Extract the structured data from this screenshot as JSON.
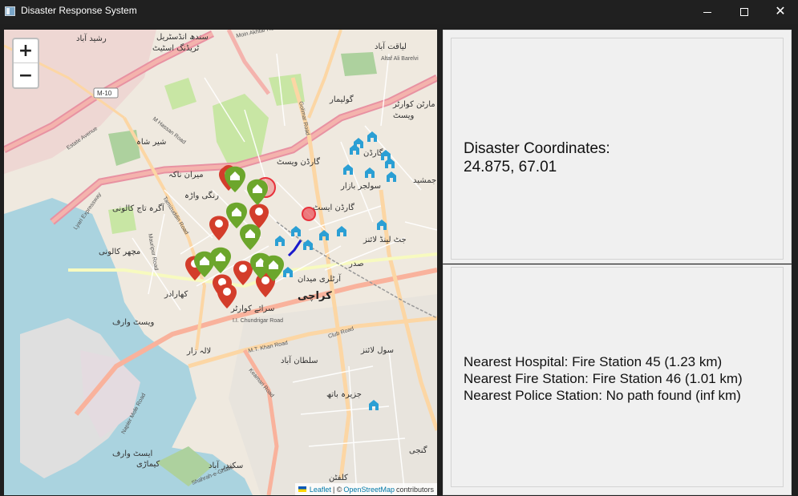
{
  "window": {
    "title": "Disaster Response System",
    "controls": {
      "minimize_icon": "minimize-icon",
      "maximize_icon": "maximize-icon",
      "close_icon": "close-icon",
      "close_glyph": "✕"
    }
  },
  "map": {
    "zoom_in_label": "+",
    "zoom_out_label": "−",
    "attribution": {
      "leaflet": "Leaflet",
      "sep": "| ©",
      "osm": "OpenStreetMap",
      "contributors": "contributors"
    },
    "labels": {
      "rashid_abad": "رشید آباد",
      "sindh_industrial": "سندھ انڈسٹریل",
      "trading_estate": "ٹریڈنگ اسٹیٹ",
      "liaquatabad": "لیاقت آباد",
      "golimar": "گولیمار",
      "martin_quarters": "مارٹن کوارٹر",
      "west": "ویسٹ",
      "sher_shah": "شیر شاہ",
      "garden": "گارڈن",
      "garden_west": "گارڈن ویسٹ",
      "soldier_bazaar": "سولجر بازار",
      "miran_naka": "میران ناکہ",
      "rangiwara": "رنگی واڑہ",
      "agra_taj": "آگرہ تاج کالونی",
      "garden_east": "گارڈن ایسٹ",
      "jamshed_road": "جمشید",
      "machar_colony": "مچھر کالونی",
      "kharadar": "کھارادر",
      "saddar": "صدر",
      "jut_land": "جٹ لینڈ لائنز",
      "artillery_maidan": "آرٹلری میدان",
      "karachi": "کراچی",
      "west_wharf": "ویسٹ وارف",
      "sarai_quarter": "سرائے کوارٹر",
      "lala_zar": "لالہ زار",
      "sultanabad": "سلطان آباد",
      "sol_lines": "سول لائنز",
      "jazira_bath": "جزیرہ باتھ",
      "east_wharf": "ایسٹ وارف",
      "kemari": "کیماڑی",
      "sikandarabad": "سکندر آباد",
      "clifton": "کلفٹن",
      "ginza": "گنجی",
      "hasan_road": "M Hassan Road",
      "estate_ave": "Estate Avenue",
      "mauripur": "Mauripur Road",
      "chundrigar": "I.I. Chundrigar Road",
      "mt_khan": "M.T. Khan Road",
      "keamari_rd": "Keamari Road",
      "napier_mole": "Napier Mole Road",
      "club_road": "Club Road",
      "shahrah": "Shahrah-e-Ghalib",
      "m10": "M-10",
      "moin_akhtar": "Moin Akhtar Road",
      "altaf_ali": "Altaf Ali Barelvi",
      "guru_mandir": "Golimar Road",
      "tamizuddin": "Tamizuddin Road",
      "lyari": "Lyari Expressway"
    }
  },
  "panels": {
    "disaster": {
      "title": "Disaster Coordinates:",
      "value": "24.875, 67.01"
    },
    "nearest": {
      "hospital": "Nearest Hospital: Fire Station 45 (1.23 km)",
      "fire": "Nearest Fire Station: Fire Station 46 (1.01 km)",
      "police": "Nearest Police Station: No path found (inf km)"
    }
  },
  "colors": {
    "hospital_marker": "#d33d2b",
    "fire_marker": "#6ca62c",
    "police_marker": "#2b9fd4",
    "disaster_circle": "#e8313b",
    "route": "#1a1acc"
  }
}
